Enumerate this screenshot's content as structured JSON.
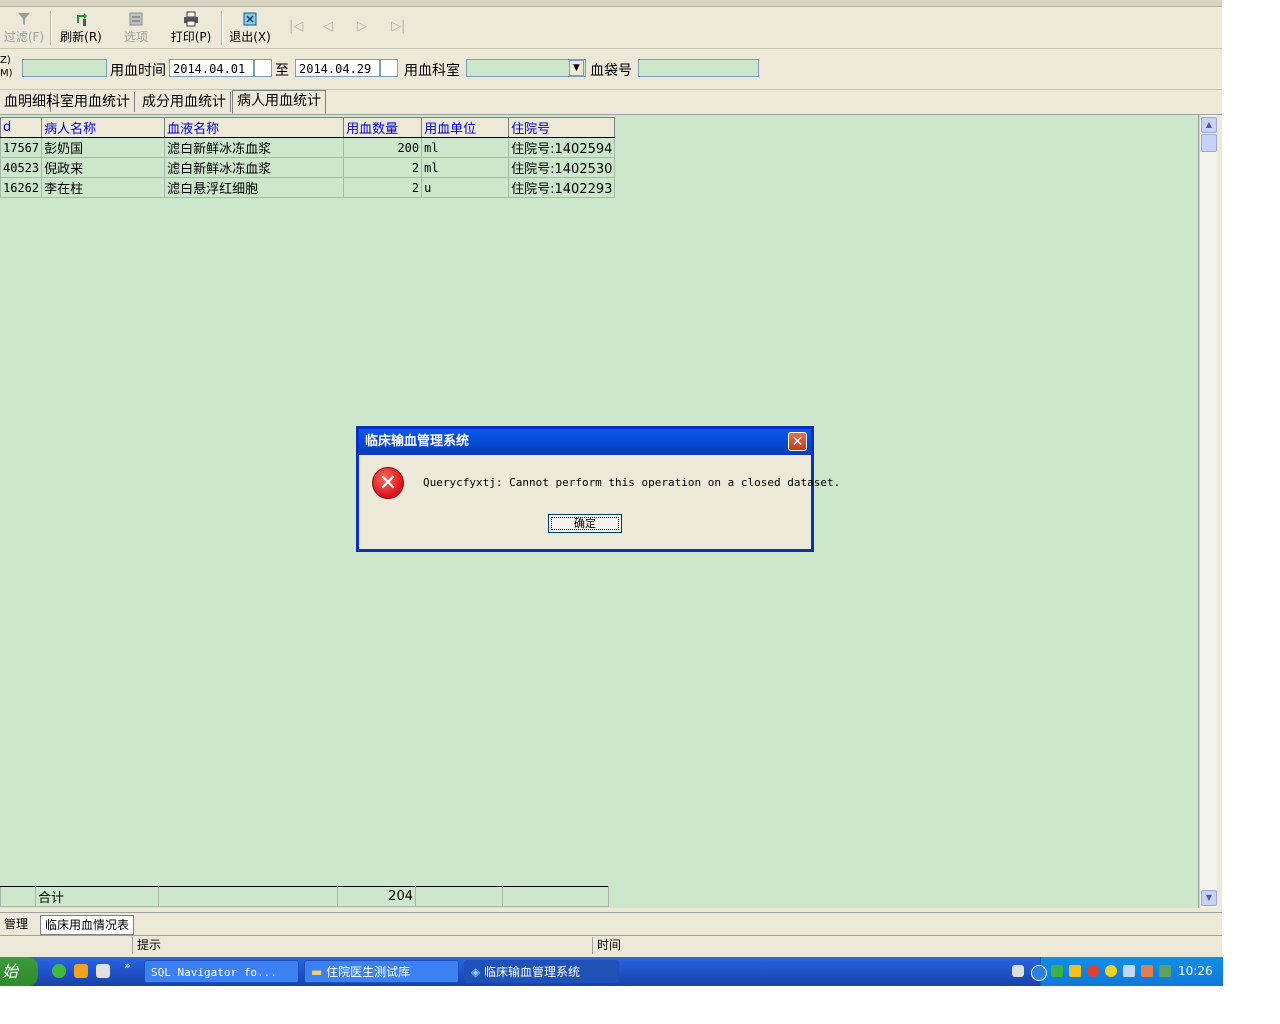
{
  "toolbar": {
    "filter": "过滤(F)",
    "refresh": "刷新(R)",
    "options": "选项",
    "print": "打印(P)",
    "exit": "退出(X)",
    "nav": [
      "|◁",
      "◁",
      "▷",
      "▷|"
    ]
  },
  "filters": {
    "left_labels": [
      "Z)",
      "M)"
    ],
    "use_time_label": "用血时间",
    "date_from": "2014.04.01",
    "to_label": "至",
    "date_to": "2014.04.29",
    "dept_label": "用血科室",
    "dept_value": "",
    "bag_label": "血袋号",
    "bag_value": "",
    "first_value": ""
  },
  "tabs": [
    "血明细",
    "科室用血统计",
    "成分用血统计",
    "病人用血统计"
  ],
  "grid": {
    "headers": [
      "d",
      "病人名称",
      "血液名称",
      "用血数量",
      "用血单位",
      "住院号"
    ],
    "rows": [
      [
        "17567",
        "彭奶国",
        "滤白新鲜冰冻血浆",
        "200",
        "ml",
        "住院号:1402594"
      ],
      [
        "40523",
        "倪政来",
        "滤白新鲜冰冻血浆",
        "2",
        "ml",
        "住院号:1402530"
      ],
      [
        "16262",
        "李在柱",
        "滤白悬浮红细胞",
        "2",
        "u",
        "住院号:1402293"
      ]
    ],
    "footer": {
      "label": "合计",
      "total": "204"
    }
  },
  "bottom_tabs": [
    "管理",
    "临床用血情况表"
  ],
  "status": {
    "hint": "提示",
    "time": "时间"
  },
  "taskbar": {
    "start": "始",
    "tasks": [
      "SQL Navigator fo...",
      "住院医生测试库",
      "临床输血管理系统"
    ],
    "clock": "10:26"
  },
  "dialog": {
    "title": "临床输血管理系统",
    "message": "Querycfyxtj: Cannot perform this operation on a closed dataset.",
    "ok": "确定"
  }
}
